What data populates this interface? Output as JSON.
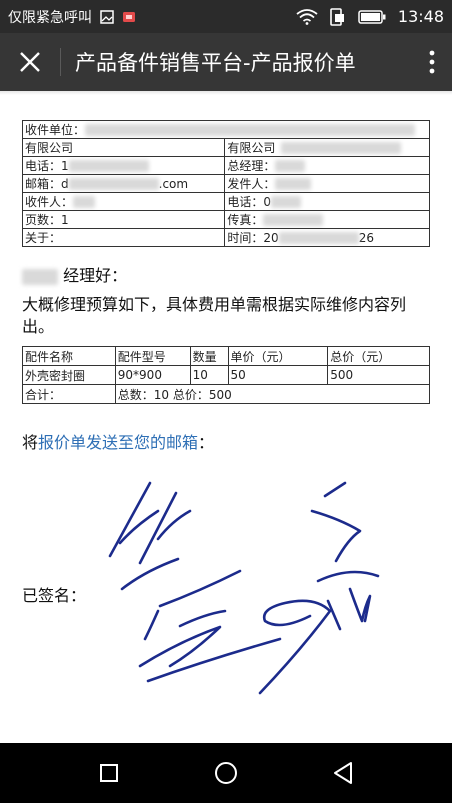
{
  "status_bar": {
    "carrier": "仅限紧急呼叫",
    "time": "13:48",
    "icons": [
      "image-icon",
      "app-notification-icon",
      "wifi-icon",
      "data-icon",
      "battery-icon"
    ]
  },
  "nav": {
    "title": "产品备件销售平台-产品报价单"
  },
  "info_table": {
    "recipient_unit_label": "收件单位：",
    "company_left": "有限公司",
    "company_right": "有限公司",
    "phone_label": "电话：1",
    "gm_label": "总经理：",
    "email_label": "邮箱：d",
    "email_suffix": ".com",
    "sender_label": "发件人：",
    "receiver_label": "收件人：",
    "phone2_label": "电话：0",
    "pages_label": "页数：1",
    "fax_label": "传真：",
    "about_label": "关于：",
    "time_label": "时间：20",
    "time_suffix": "26"
  },
  "greeting": "经理好：",
  "body_text": "大概修理预算如下，具体费用单需根据实际维修内容列出。",
  "items_table": {
    "headers": [
      "配件名称",
      "配件型号",
      "数量",
      "单价（元）",
      "总价（元）"
    ],
    "row": [
      "外壳密封圈",
      "90*900",
      "10",
      "50",
      "500"
    ],
    "total_label": "合计：",
    "total_value": "总数：10 总价：500"
  },
  "send_prefix": "将",
  "send_link": "报价单发送至您的邮箱",
  "send_suffix": "：",
  "signed_label": "已签名：",
  "colors": {
    "status_bar": "#2b2b2b",
    "nav_bar": "#363636",
    "link": "#2e6fb5",
    "signature_ink": "#1c2b8c"
  }
}
